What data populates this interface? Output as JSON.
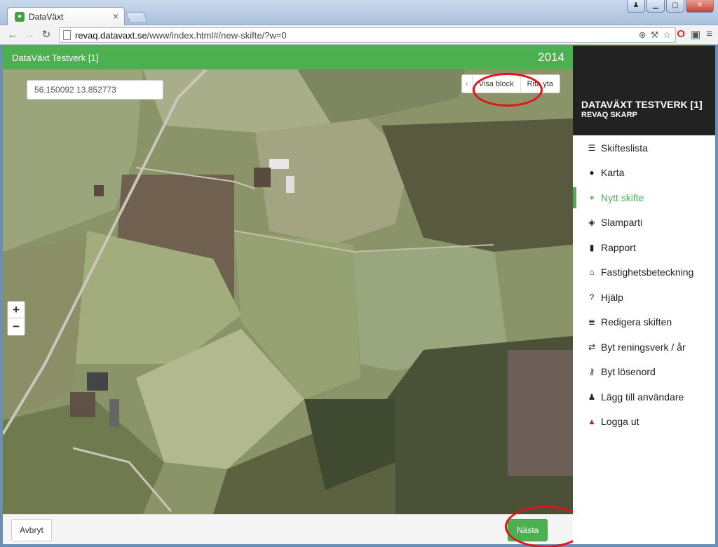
{
  "browser": {
    "tab_title": "DataVäxt",
    "url_host": "revaq.datavaxt.se",
    "url_path": "/www/index.html#/new-skifte/?w=0"
  },
  "header": {
    "title": "DataVäxt Testverk [1]",
    "year": "2014"
  },
  "map": {
    "coordinates": "56.150092 13.852773",
    "tools": [
      "Visa block",
      "Rita yta"
    ],
    "zoom_in": "+",
    "zoom_out": "−"
  },
  "footer": {
    "cancel_label": "Avbryt",
    "next_label": "Nästa"
  },
  "sidebar": {
    "title": "DATAVÄXT TESTVERK [1]",
    "subtitle": "REVAQ SKARP",
    "items": [
      {
        "label": "Skifteslista",
        "icon": "list-icon"
      },
      {
        "label": "Karta",
        "icon": "globe-icon"
      },
      {
        "label": "Nytt skifte",
        "icon": "plus-icon",
        "active": true
      },
      {
        "label": "Slamparti",
        "icon": "cubes-icon"
      },
      {
        "label": "Rapport",
        "icon": "file-icon"
      },
      {
        "label": "Fastighetsbeteckning",
        "icon": "home-icon"
      },
      {
        "label": "Hjälp",
        "icon": "question-icon"
      },
      {
        "label": "Redigera skiften",
        "icon": "tasks-icon"
      },
      {
        "label": "Byt reningsverk / år",
        "icon": "exchange-icon"
      },
      {
        "label": "Byt lösenord",
        "icon": "key-icon"
      },
      {
        "label": "Lägg till användare",
        "icon": "user-icon"
      },
      {
        "label": "Logga ut",
        "icon": "warning-icon"
      }
    ]
  },
  "colors": {
    "brand_green": "#4caf50",
    "sidebar_dark": "#222222",
    "annotation_red": "#e0151a"
  }
}
